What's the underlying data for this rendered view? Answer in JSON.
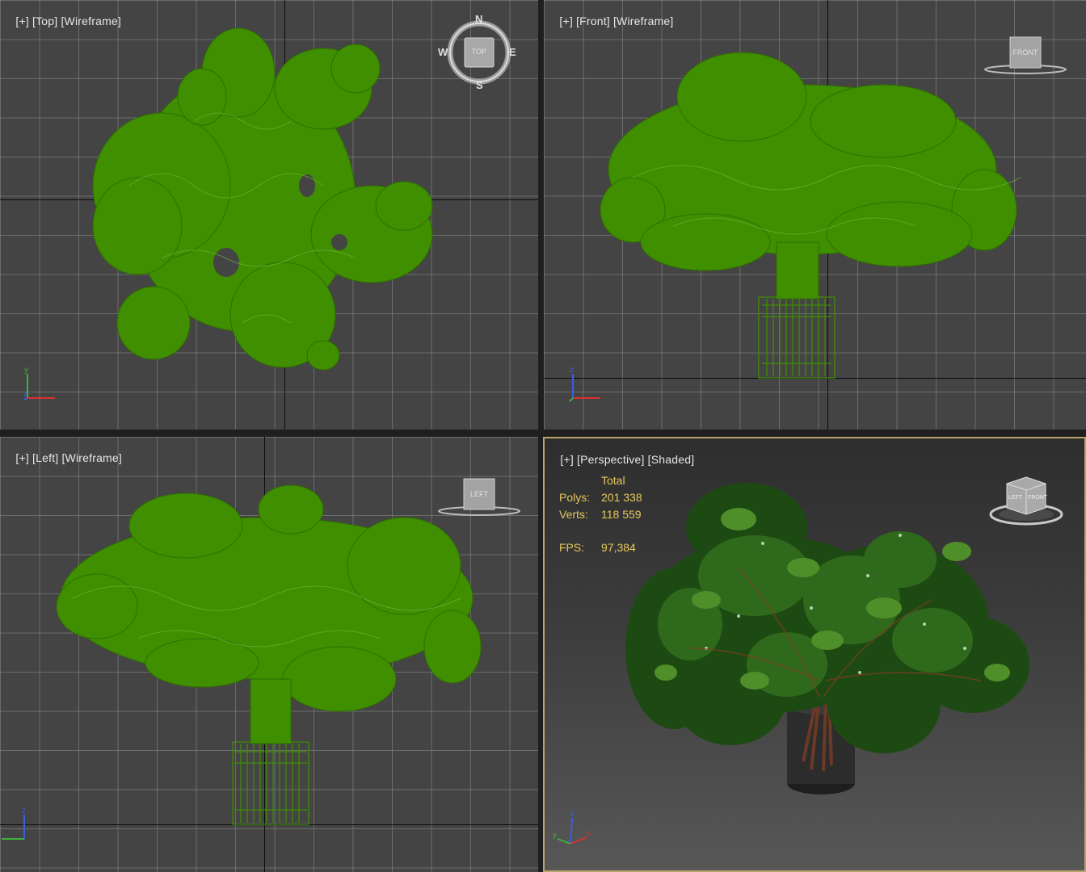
{
  "viewports": {
    "top": {
      "plus": "[+]",
      "view": "[Top]",
      "mode": "[Wireframe]",
      "cube_label": "TOP",
      "compass": {
        "n": "N",
        "s": "S",
        "e": "E",
        "w": "W"
      },
      "axes": {
        "a": "y",
        "b": "z",
        "c": "x"
      }
    },
    "front": {
      "plus": "[+]",
      "view": "[Front]",
      "mode": "[Wireframe]",
      "cube_label": "FRONT",
      "axes": {
        "a": "z",
        "b": "y",
        "c": "x"
      }
    },
    "left": {
      "plus": "[+]",
      "view": "[Left]",
      "mode": "[Wireframe]",
      "cube_label": "LEFT",
      "axes": {
        "a": "z",
        "b": "y",
        "c": "x"
      }
    },
    "perspective": {
      "plus": "[+]",
      "view": "[Perspective]",
      "mode": "[Shaded]",
      "cube_labels": {
        "left": "LEFT",
        "front": "FRONT"
      },
      "axes": {
        "a": "z",
        "b": "y",
        "c": "x"
      },
      "stats": {
        "header": "Total",
        "polys_label": "Polys:",
        "polys_value": "201 338",
        "verts_label": "Verts:",
        "verts_value": "118 559",
        "fps_label": "FPS:",
        "fps_value": "97,384"
      }
    }
  },
  "colors": {
    "wire_green": "#3f8f00",
    "viewport_bg": "#444444",
    "active_border": "#b9a46e",
    "stats_text": "#e7c85a",
    "leaf_dark": "#1d4a12",
    "leaf_light": "#4f8f2a"
  }
}
